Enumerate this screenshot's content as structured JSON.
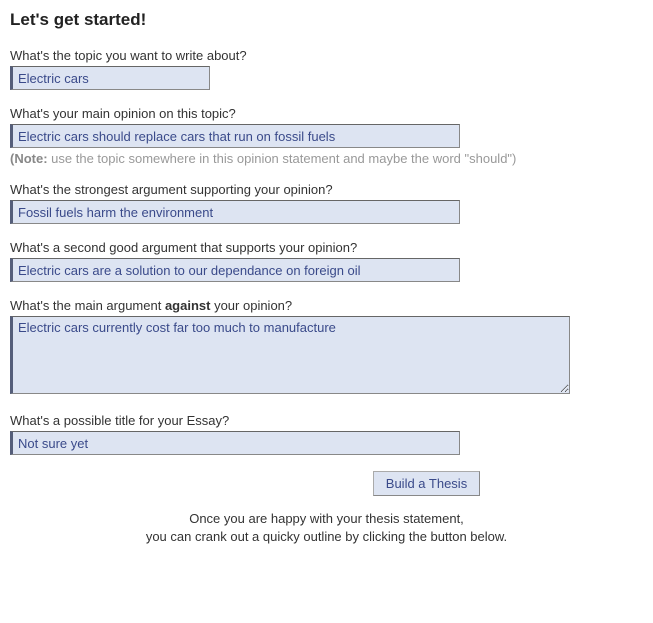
{
  "heading": "Let's get started!",
  "fields": {
    "topic": {
      "question": "What's the topic you want to write about?",
      "value": "Electric cars"
    },
    "opinion": {
      "question": "What's your main opinion on this topic?",
      "value": "Electric cars should replace cars that run on fossil fuels",
      "note_bold": "(Note:",
      "note_rest": " use the topic somewhere in this opinion statement and maybe the word \"should\")"
    },
    "arg1": {
      "question": "What's the strongest argument supporting your opinion?",
      "value": "Fossil fuels harm the environment"
    },
    "arg2": {
      "question": "What's a second good argument that supports your opinion?",
      "value": "Electric cars are a solution to our dependance on foreign oil"
    },
    "against": {
      "question_pre": "What's the main argument ",
      "question_bold": "against",
      "question_post": " your opinion?",
      "value": "Electric cars currently cost far too much to manufacture"
    },
    "title": {
      "question": "What's a possible title for your Essay?",
      "value": "Not sure yet"
    }
  },
  "button_label": "Build a Thesis",
  "footer_line1": "Once you are happy with your thesis statement,",
  "footer_line2": "you can crank out a quicky outline by clicking the button below."
}
